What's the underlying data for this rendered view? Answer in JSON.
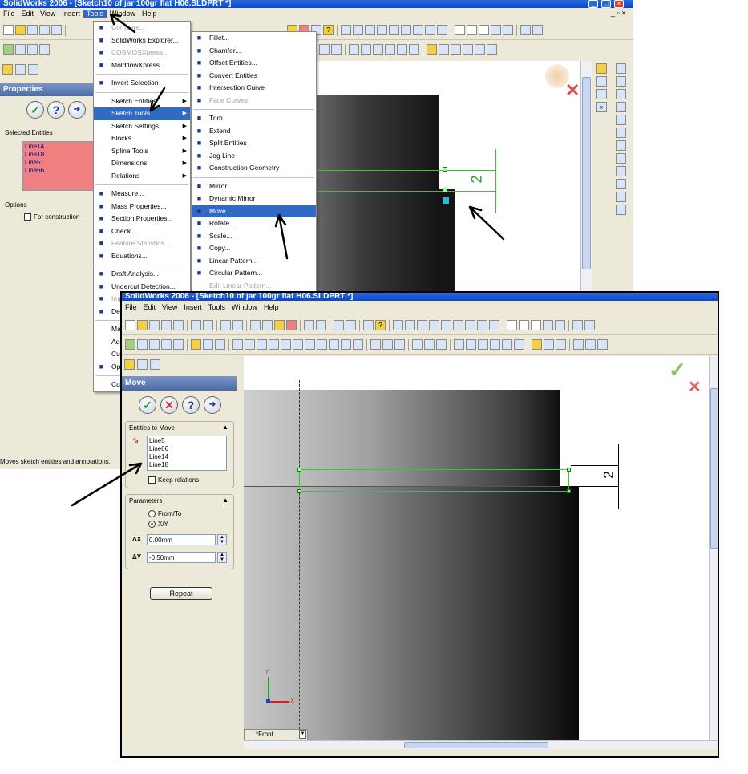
{
  "top_window": {
    "title": "SolidWorks 2006 - [Sketch10 of jar 100gr flat H06.SLDPRT *]",
    "menu": [
      "File",
      "Edit",
      "View",
      "Insert",
      "Tools",
      "Window",
      "Help"
    ],
    "property_title": "Properties",
    "selected_entities_label": "Selected Entities",
    "selected_entities": [
      "Line14",
      "Line18",
      "Line5",
      "Line66"
    ],
    "options_label": "Options",
    "for_construction_label": "For construction",
    "status_text": "Moves sketch entities and annotations.",
    "dimension_value": "2"
  },
  "tools_menu": {
    "items": [
      {
        "label": "Compare...",
        "disabled": true,
        "icon": "compare-icon"
      },
      {
        "label": "SolidWorks Explorer...",
        "icon": "explorer-icon"
      },
      {
        "label": "COSMOSXpress...",
        "disabled": true,
        "icon": "cosmos-icon"
      },
      {
        "label": "MoldflowXpress...",
        "icon": "moldflow-icon"
      },
      {
        "sep": true
      },
      {
        "label": "Invert Selection",
        "icon": "invert-selection-icon"
      },
      {
        "sep": true
      },
      {
        "label": "Sketch Entities",
        "submenu": true
      },
      {
        "label": "Sketch Tools",
        "submenu": true,
        "selected": true
      },
      {
        "label": "Sketch Settings",
        "submenu": true
      },
      {
        "label": "Blocks",
        "submenu": true
      },
      {
        "label": "Spline Tools",
        "submenu": true
      },
      {
        "label": "Dimensions",
        "submenu": true
      },
      {
        "label": "Relations",
        "submenu": true
      },
      {
        "sep": true
      },
      {
        "label": "Measure...",
        "icon": "measure-icon"
      },
      {
        "label": "Mass Properties...",
        "icon": "mass-properties-icon"
      },
      {
        "label": "Section Properties...",
        "icon": "section-properties-icon"
      },
      {
        "label": "Check...",
        "icon": "check-icon"
      },
      {
        "label": "Feature Statistics...",
        "disabled": true,
        "icon": "feature-statistics-icon"
      },
      {
        "label": "Equations...",
        "icon": "equations-icon"
      },
      {
        "sep": true
      },
      {
        "label": "Draft Analysis...",
        "icon": "draft-analysis-icon"
      },
      {
        "label": "Undercut Detection...",
        "icon": "undercut-icon"
      },
      {
        "label": "Imp",
        "disabled": true,
        "icon": "import-icon"
      },
      {
        "label": "Dev",
        "icon": "dev-icon"
      },
      {
        "sep": true
      },
      {
        "label": "Ma"
      },
      {
        "label": "Add"
      },
      {
        "label": "Cus"
      },
      {
        "label": "Opt",
        "icon": "options-icon"
      },
      {
        "sep": true
      },
      {
        "label": "Cus"
      }
    ]
  },
  "sketch_tools_menu": {
    "items": [
      {
        "label": "Fillet...",
        "icon": "fillet-icon"
      },
      {
        "label": "Chamfer...",
        "icon": "chamfer-icon"
      },
      {
        "label": "Offset Entities...",
        "icon": "offset-icon"
      },
      {
        "label": "Convert Entities",
        "icon": "convert-icon"
      },
      {
        "label": "Intersection Curve",
        "icon": "intersection-icon"
      },
      {
        "label": "Face Curves",
        "disabled": true,
        "icon": "face-curves-icon"
      },
      {
        "sep": true
      },
      {
        "label": "Trim",
        "icon": "trim-icon"
      },
      {
        "label": "Extend",
        "icon": "extend-icon"
      },
      {
        "label": "Split Entities",
        "icon": "split-icon"
      },
      {
        "label": "Jog Line",
        "icon": "jog-line-icon"
      },
      {
        "label": "Construction Geometry",
        "icon": "construction-geometry-icon"
      },
      {
        "sep": true
      },
      {
        "label": "Mirror",
        "icon": "mirror-icon"
      },
      {
        "label": "Dynamic Mirror",
        "icon": "dynamic-mirror-icon"
      },
      {
        "label": "Move...",
        "selected": true,
        "icon": "move-icon"
      },
      {
        "label": "Rotate...",
        "icon": "rotate-icon"
      },
      {
        "label": "Scale...",
        "icon": "scale-icon"
      },
      {
        "label": "Copy...",
        "icon": "copy-icon"
      },
      {
        "label": "Linear Pattern...",
        "icon": "linear-pattern-icon"
      },
      {
        "label": "Circular Pattern...",
        "icon": "circular-pattern-icon"
      },
      {
        "label": "Edit Linear Pattern...",
        "disabled": true
      }
    ]
  },
  "bottom_window": {
    "title": "SolidWorks 2006 - [Sketch10 of jar 100gr flat H06.SLDPRT *]",
    "menu": [
      "File",
      "Edit",
      "View",
      "Insert",
      "Tools",
      "Window",
      "Help"
    ],
    "property_title": "Move",
    "entities_to_move_label": "Entities to Move",
    "entities": [
      "Line5",
      "Line66",
      "Line14",
      "Line18"
    ],
    "keep_relations_label": "Keep relations",
    "parameters_label": "Parameters",
    "from_to_label": "From/To",
    "xy_label": "X/Y",
    "xy_selected": true,
    "dx_label": "ΔX",
    "dx_value": "0.00mm",
    "dy_label": "ΔY",
    "dy_value": "-0.50mm",
    "repeat_label": "Repeat",
    "dimension_value": "2",
    "view_tab": "*Front",
    "axis_x": "X",
    "axis_y": "Y"
  }
}
